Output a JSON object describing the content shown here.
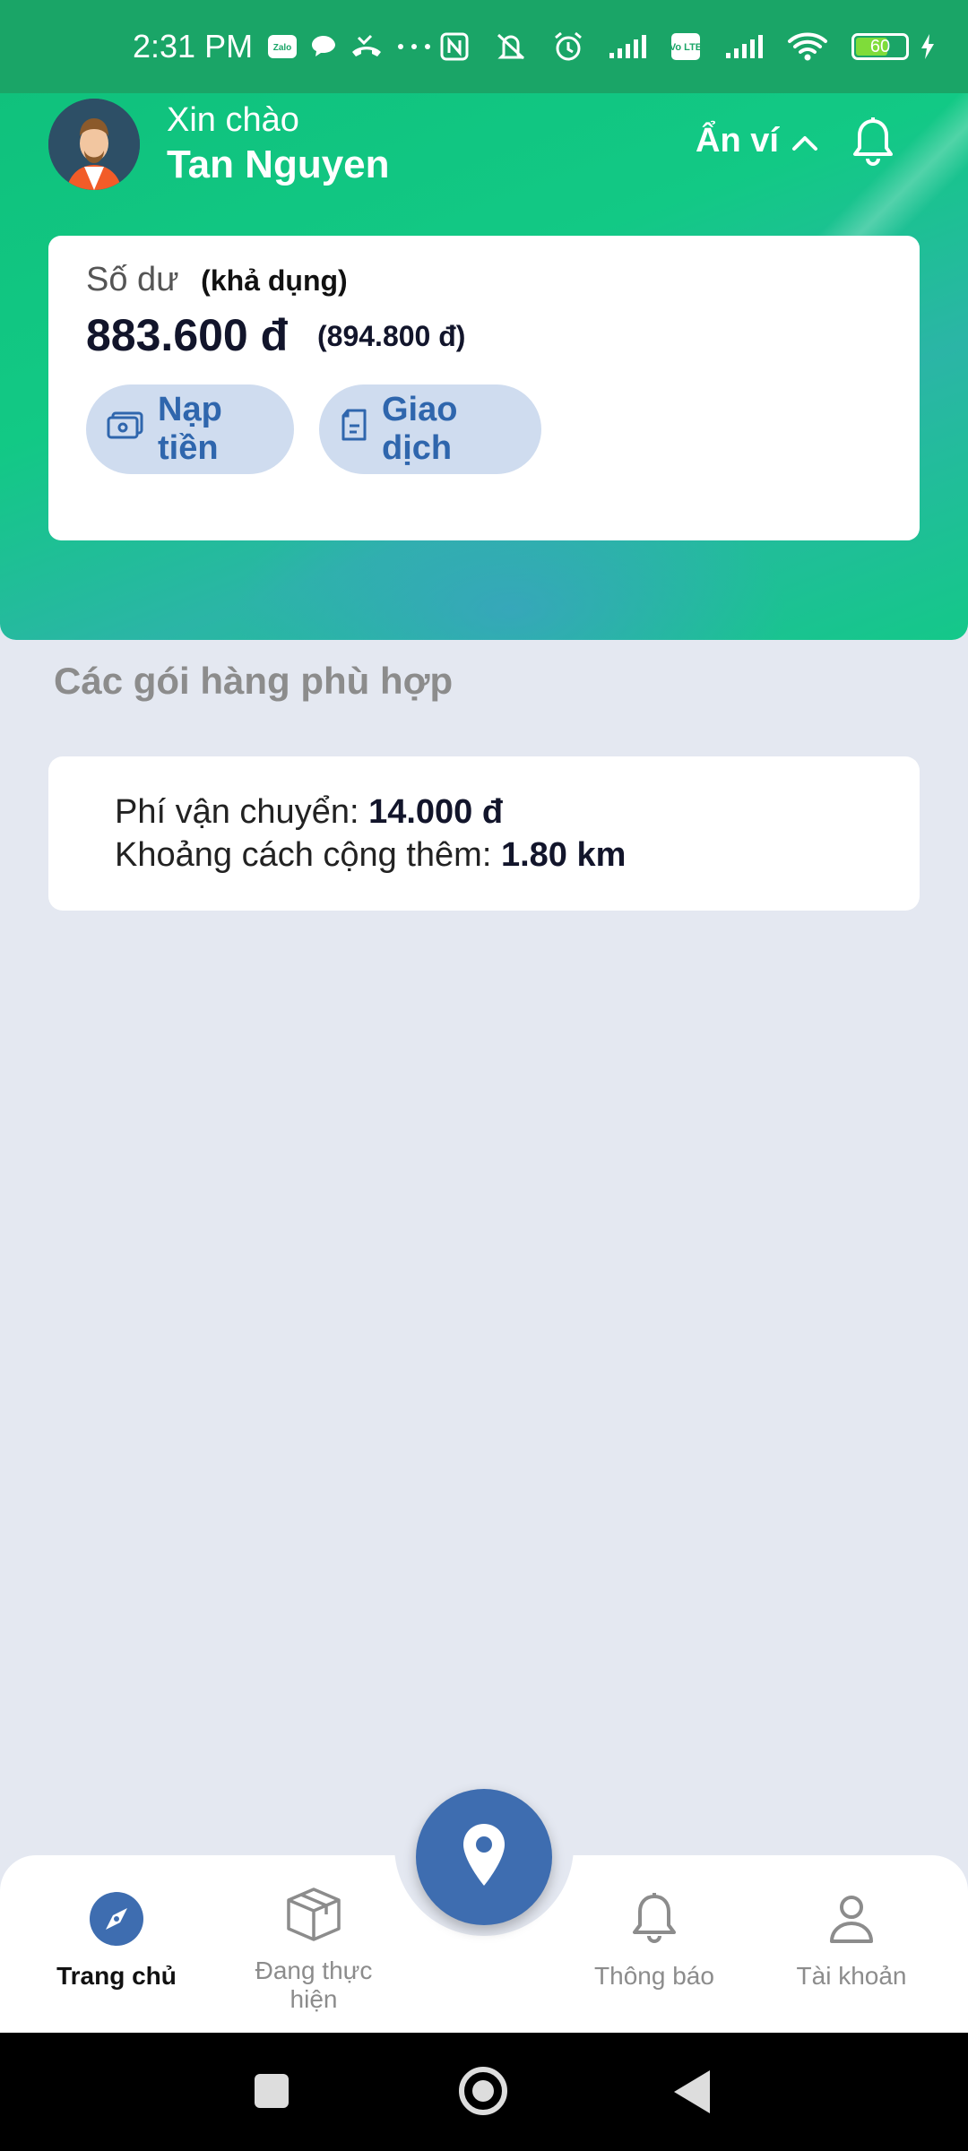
{
  "status_bar": {
    "time": "2:31 PM",
    "app_badge": "Zalo",
    "volte_badge": "Vo LTE",
    "battery_level": "60",
    "icons": [
      "zalo-icon",
      "chat-bubble-icon",
      "missed-call-icon",
      "more-dots-icon",
      "nfc-icon",
      "mute-icon",
      "alarm-icon",
      "signal-icon",
      "volte-icon",
      "signal-icon",
      "wifi-icon",
      "battery-icon",
      "charging-icon"
    ]
  },
  "header": {
    "greeting": "Xin chào",
    "user_name": "Tan Nguyen",
    "hide_wallet_label": "Ẩn ví",
    "accent_color": "#12c985"
  },
  "balance": {
    "label": "Số dư",
    "sub_label": "(khả dụng)",
    "available": "883.600 đ",
    "total": "(894.800 đ)",
    "topup_label": "Nạp tiền",
    "transactions_label": "Giao dịch"
  },
  "section": {
    "title": "Các gói hàng phù hợp"
  },
  "package": {
    "fee_label": "Phí vận chuyển:",
    "fee_value": "14.000 đ",
    "distance_label": "Khoảng cách cộng thêm:",
    "distance_value": "1.80 km"
  },
  "bottom_nav": {
    "home": "Trang chủ",
    "ongoing": "Đang thực hiện",
    "notifications": "Thông báo",
    "account": "Tài khoản",
    "primary_color": "#3e6db0"
  }
}
